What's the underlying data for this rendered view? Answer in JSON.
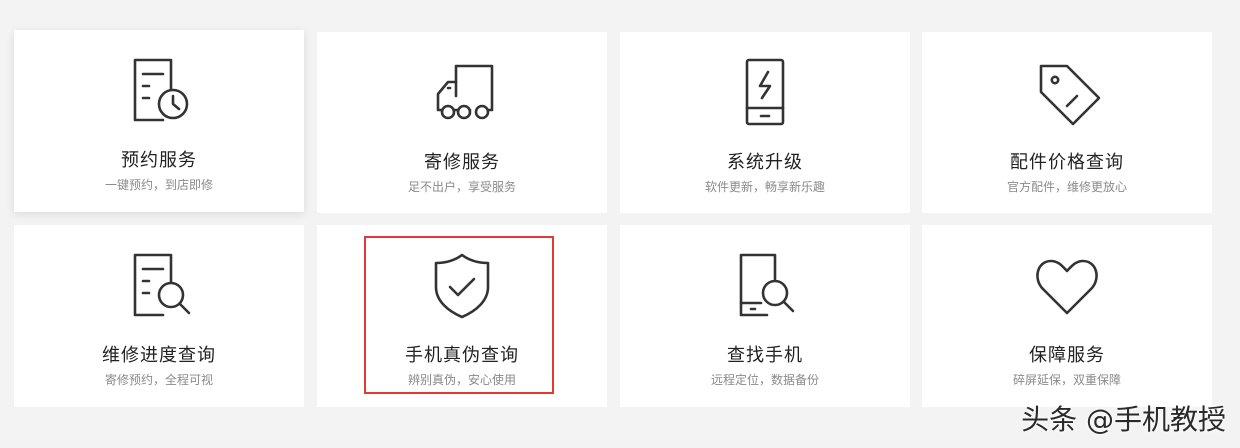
{
  "services": [
    {
      "title": "预约服务",
      "subtitle": "一键预约，到店即修",
      "icon": "document-clock-icon"
    },
    {
      "title": "寄修服务",
      "subtitle": "足不出户，享受服务",
      "icon": "delivery-truck-icon"
    },
    {
      "title": "系统升级",
      "subtitle": "软件更新，畅享新乐趣",
      "icon": "phone-bolt-icon"
    },
    {
      "title": "配件价格查询",
      "subtitle": "官方配件，维修更放心",
      "icon": "price-tag-icon"
    },
    {
      "title": "维修进度查询",
      "subtitle": "寄修预约，全程可视",
      "icon": "document-search-icon"
    },
    {
      "title": "手机真伪查询",
      "subtitle": "辨别真伪，安心使用",
      "icon": "shield-check-icon"
    },
    {
      "title": "查找手机",
      "subtitle": "远程定位，数据备份",
      "icon": "phone-search-icon"
    },
    {
      "title": "保障服务",
      "subtitle": "碎屏延保，双重保障",
      "icon": "heart-icon"
    }
  ],
  "watermark": "头条 @手机教授",
  "colors": {
    "highlight": "#e03a35",
    "icon_stroke": "#333333",
    "background": "#f3f3f3"
  }
}
